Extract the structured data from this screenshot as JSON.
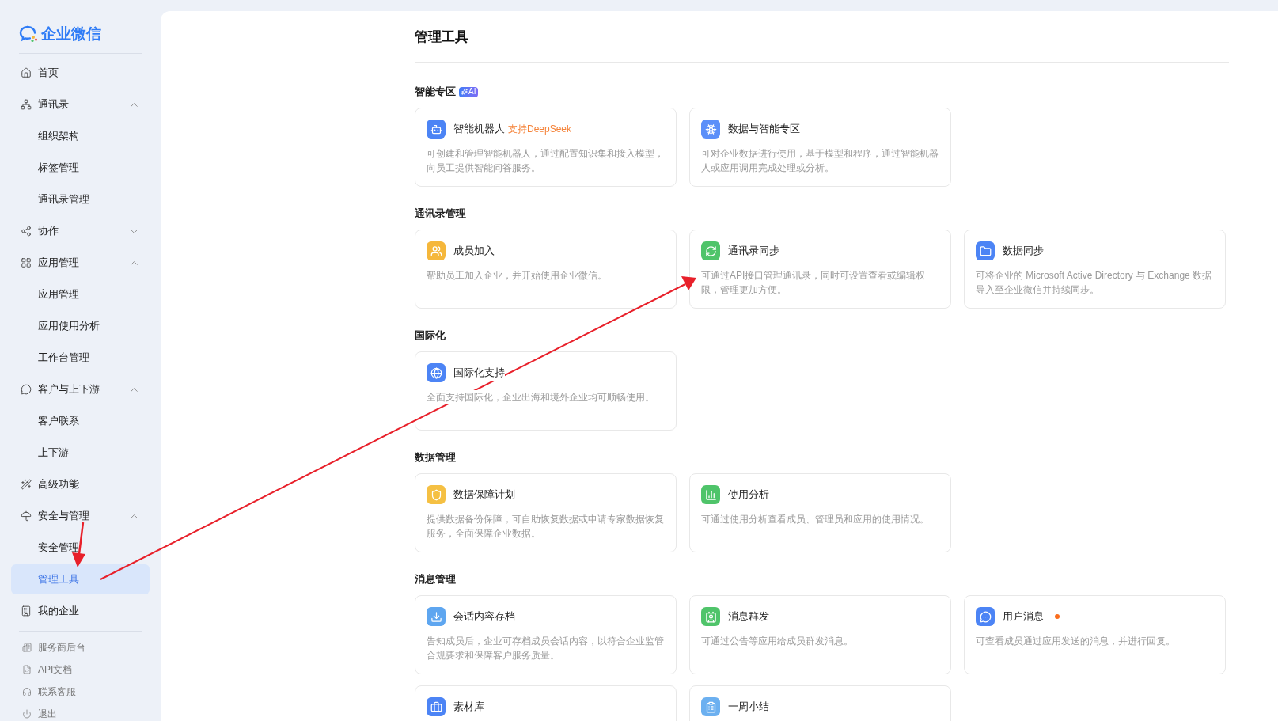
{
  "sidebar": {
    "logo": "企业微信",
    "nav": [
      {
        "label": "首页",
        "kind": "link",
        "selected": false
      },
      {
        "label": "通讯录",
        "kind": "group",
        "expanded": true,
        "selected": false,
        "children": [
          {
            "label": "组织架构",
            "selected": false
          },
          {
            "label": "标签管理",
            "selected": false
          },
          {
            "label": "通讯录管理",
            "selected": false
          }
        ]
      },
      {
        "label": "协作",
        "kind": "group",
        "expanded": false,
        "selected": false
      },
      {
        "label": "应用管理",
        "kind": "group",
        "expanded": true,
        "selected": false,
        "children": [
          {
            "label": "应用管理",
            "selected": false
          },
          {
            "label": "应用使用分析",
            "selected": false
          },
          {
            "label": "工作台管理",
            "selected": false
          }
        ]
      },
      {
        "label": "客户与上下游",
        "kind": "group",
        "expanded": true,
        "selected": false,
        "children": [
          {
            "label": "客户联系",
            "selected": false
          },
          {
            "label": "上下游",
            "selected": false
          }
        ]
      },
      {
        "label": "高级功能",
        "kind": "link",
        "selected": false
      },
      {
        "label": "安全与管理",
        "kind": "group",
        "expanded": true,
        "selected": false,
        "children": [
          {
            "label": "安全管理",
            "selected": false
          },
          {
            "label": "管理工具",
            "selected": true
          }
        ]
      },
      {
        "label": "我的企业",
        "kind": "link",
        "selected": false
      }
    ],
    "footer": [
      "服务商后台",
      "API文档",
      "联系客服",
      "退出"
    ]
  },
  "page": {
    "title": "管理工具",
    "sections": [
      {
        "heading": "智能专区",
        "badge": "AI",
        "cards": [
          {
            "title": "智能机器人",
            "tag": "支持DeepSeek",
            "color": "#4c84f5",
            "description": "可创建和管理智能机器人，通过配置知识集和接入模型，向员工提供智能问答服务。"
          },
          {
            "title": "数据与智能专区",
            "color": "#5b8ff9",
            "description": "可对企业数据进行使用，基于模型和程序，通过智能机器人或应用调用完成处理或分析。"
          }
        ]
      },
      {
        "heading": "通讯录管理",
        "cards": [
          {
            "title": "成员加入",
            "color": "#f5b73b",
            "description": "帮助员工加入企业，并开始使用企业微信。"
          },
          {
            "title": "通讯录同步",
            "color": "#4fc46a",
            "description": "可通过API接口管理通讯录，同时可设置查看或编辑权限，管理更加方便。"
          },
          {
            "title": "数据同步",
            "color": "#4c84f5",
            "description": "可将企业的 Microsoft Active Directory 与 Exchange 数据导入至企业微信并持续同步。"
          }
        ]
      },
      {
        "heading": "国际化",
        "cards": [
          {
            "title": "国际化支持",
            "color": "#4c84f5",
            "description": "全面支持国际化，企业出海和境外企业均可顺畅使用。"
          }
        ]
      },
      {
        "heading": "数据管理",
        "cards": [
          {
            "title": "数据保障计划",
            "color": "#f5c043",
            "description": "提供数据备份保障，可自助恢复数据或申请专家数据恢复服务，全面保障企业数据。"
          },
          {
            "title": "使用分析",
            "color": "#4fc46a",
            "description": "可通过使用分析查看成员、管理员和应用的使用情况。"
          }
        ]
      },
      {
        "heading": "消息管理",
        "cards": [
          {
            "title": "会话内容存档",
            "color": "#5ea6f0",
            "description": "告知成员后，企业可存档成员会话内容，以符合企业监管合规要求和保障客户服务质量。"
          },
          {
            "title": "消息群发",
            "color": "#4fc46a",
            "description": "可通过公告等应用给成员群发消息。"
          },
          {
            "title": "用户消息",
            "color": "#4c84f5",
            "unread": true,
            "description": "可查看成员通过应用发送的消息，并进行回复。"
          },
          {
            "title": "素材库",
            "color": "#4c84f5"
          },
          {
            "title": "一周小结",
            "color": "#6cb0f0"
          }
        ]
      }
    ]
  }
}
